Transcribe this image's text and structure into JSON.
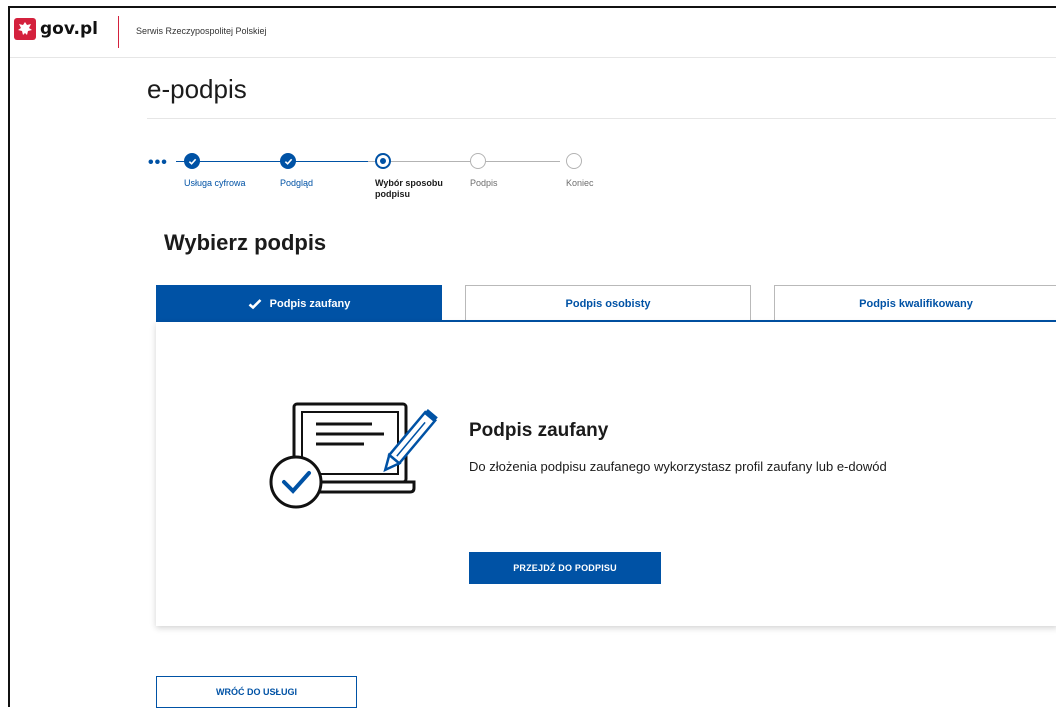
{
  "header": {
    "logo_text": "gov.pl",
    "service_name": "Serwis Rzeczypospolitej Polskiej"
  },
  "app": {
    "title": "e-podpis"
  },
  "stepper": {
    "more": "•••",
    "steps": [
      {
        "label": "Usługa cyfrowa",
        "state": "done"
      },
      {
        "label": "Podgląd",
        "state": "done"
      },
      {
        "label": "Wybór sposobu podpisu",
        "state": "current"
      },
      {
        "label": "Podpis",
        "state": "todo"
      },
      {
        "label": "Koniec",
        "state": "todo"
      }
    ]
  },
  "main": {
    "heading": "Wybierz podpis",
    "tabs": [
      {
        "label": "Podpis zaufany",
        "selected": true
      },
      {
        "label": "Podpis osobisty",
        "selected": false
      },
      {
        "label": "Podpis kwalifikowany",
        "selected": false
      }
    ],
    "card": {
      "icon": "signed-document-illustration",
      "title": "Podpis zaufany",
      "description": "Do złożenia podpisu zaufanego wykorzystasz profil zaufany lub e-dowód",
      "button": "PRZEJDŹ DO PODPISU"
    },
    "back_button": "WRÓĆ DO USŁUGI"
  },
  "colors": {
    "primary": "#0052a5",
    "brand_red": "#d4213d"
  }
}
